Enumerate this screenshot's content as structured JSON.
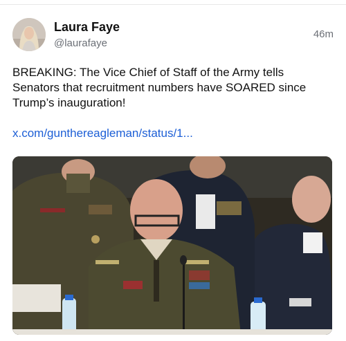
{
  "post": {
    "author": {
      "display_name": "Laura Faye",
      "handle": "@laurafaye"
    },
    "timestamp": "46m",
    "text": "BREAKING: The Vice Chief of Staff of the Army tells Senators that recruitment numbers have SOARED since Trump’s inauguration!",
    "link_text": "x.com/gunthereagleman/status/1..."
  },
  "icons": {
    "avatar": "profile-photo",
    "media": "video-still-hearing"
  }
}
